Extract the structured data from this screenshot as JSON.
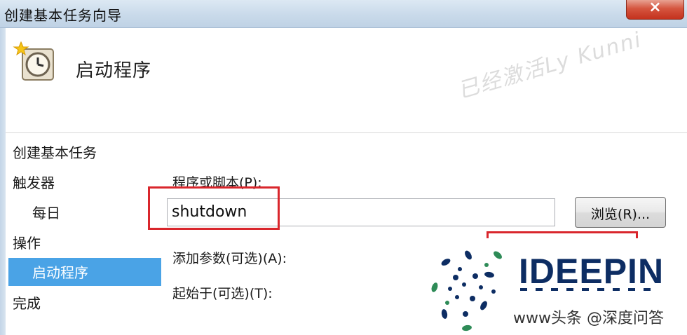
{
  "window": {
    "title": "创建基本任务向导",
    "close_label": "×"
  },
  "header": {
    "title": "启动程序",
    "watermark": "已经激活Ly Kunni"
  },
  "sidebar": {
    "heading": "创建基本任务",
    "steps": [
      {
        "label": "触发器"
      },
      {
        "label": "每日"
      },
      {
        "label": "操作"
      },
      {
        "label": "启动程序"
      },
      {
        "label": "完成"
      }
    ],
    "selected_index": 3
  },
  "form": {
    "program_label": "程序或脚本(P):",
    "program_value": "shutdown",
    "browse_label": "浏览(R)...",
    "args_label": "添加参数(可选)(A):",
    "start_in_label": "起始于(可选)(T):"
  },
  "overlay": {
    "logo_text": "IDEEPIN",
    "caption": "www头条 @深度问答"
  },
  "colors": {
    "selected_bg": "#4aa3e6",
    "highlight_red": "#d9262c",
    "logo_blue": "#0d2d63",
    "logo_green": "#2e8b57"
  }
}
